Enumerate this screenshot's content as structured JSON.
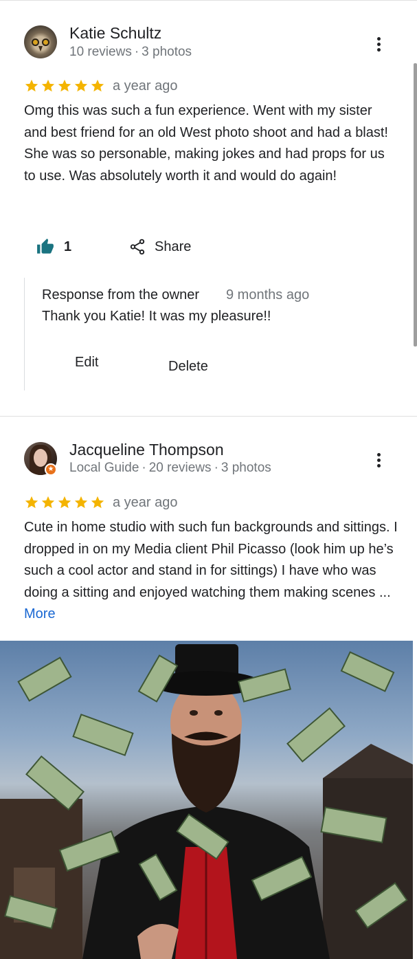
{
  "reviews": [
    {
      "author": "Katie Schultz",
      "reviews_count": "10 reviews",
      "photos_count": "3 photos",
      "rating": 5,
      "date": "a year ago",
      "text": "Omg this was such a fun experience. Went with my sister and best friend for an old West photo shoot and had a blast! She was so personable, making jokes and had props for us to use. Was absolutely worth it and would do again!",
      "likes": "1",
      "share_label": "Share",
      "owner_response": {
        "title": "Response from the owner",
        "date": "9 months ago",
        "text": "Thank you Katie! It was my pleasure!!",
        "edit_label": "Edit",
        "delete_label": "Delete"
      },
      "avatar_icon": "owl-avatar"
    },
    {
      "author": "Jacqueline Thompson",
      "badge": "Local Guide",
      "reviews_count": "20 reviews",
      "photos_count": "3 photos",
      "rating": 5,
      "date": "a year ago",
      "text": "Cute in home studio with such fun backgrounds and sittings. I dropped in on my Media client Phil Picasso (look him up he’s such a cool actor and stand in for sittings) I have who was doing a sitting and enjoyed watching them making scenes ...",
      "more_label": "More",
      "avatar_icon": "woman-avatar",
      "photo_icon": "man-top-hat-money-photo"
    }
  ],
  "colors": {
    "star": "#F4B400",
    "like_icon": "#1A7380",
    "link": "#1967D2",
    "secondary_text": "#70757A",
    "guide_badge": "#E8711A"
  }
}
